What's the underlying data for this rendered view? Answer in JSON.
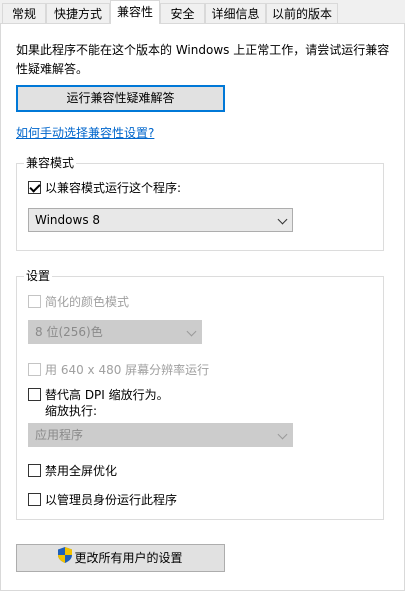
{
  "tabs": [
    {
      "label": "常规"
    },
    {
      "label": "快捷方式"
    },
    {
      "label": "兼容性"
    },
    {
      "label": "安全"
    },
    {
      "label": "详细信息"
    },
    {
      "label": "以前的版本"
    }
  ],
  "active_tab": "兼容性",
  "description": "如果此程序不能在这个版本的 Windows 上正常工作，请尝试运行兼容性疑难解答。",
  "troubleshooter_button": "运行兼容性疑难解答",
  "manual_link": "如何手动选择兼容性设置?",
  "compat_mode": {
    "group_label": "兼容模式",
    "checkbox_label": "以兼容模式运行这个程序:",
    "checked": true,
    "selected_os": "Windows 8"
  },
  "settings": {
    "group_label": "设置",
    "reduced_color": {
      "label": "简化的颜色模式",
      "checked": false,
      "enabled": false
    },
    "color_select": {
      "value": "8 位(256)色",
      "enabled": false
    },
    "res_640": {
      "label": "用 640 x 480 屏幕分辨率运行",
      "checked": false,
      "enabled": false
    },
    "dpi_override": {
      "label": "替代高 DPI 缩放行为。",
      "sub_label": "缩放执行:",
      "checked": false
    },
    "dpi_select": {
      "value": "应用程序",
      "enabled": false
    },
    "disable_fullscreen": {
      "label": "禁用全屏优化",
      "checked": false
    },
    "run_as_admin": {
      "label": "以管理员身份运行此程序",
      "checked": false
    }
  },
  "all_users_button": "更改所有用户的设置",
  "colors": {
    "accent": "#0078d7",
    "link": "#0066cc",
    "disabled": "#a0a0a0"
  },
  "icons": {
    "all_users_button": "uac-shield-icon"
  }
}
